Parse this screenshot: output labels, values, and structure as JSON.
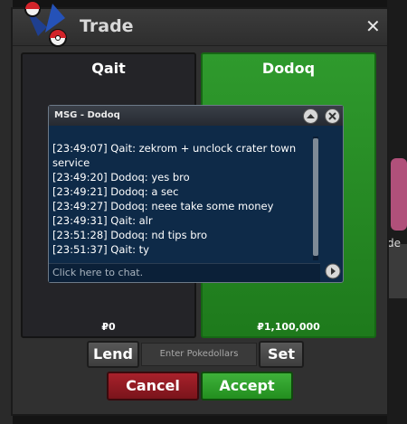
{
  "window": {
    "title": "Trade"
  },
  "trade": {
    "left_name": "Qait",
    "right_name": "Dodoq",
    "left_money": "₽0",
    "right_money": "₽1,100,000"
  },
  "controls": {
    "lend_label": "Lend",
    "money_placeholder": "Enter Pokedollars",
    "set_label": "Set",
    "cancel_label": "Cancel",
    "accept_label": "Accept"
  },
  "chat": {
    "title": "MSG - Dodoq",
    "messages": [
      "[23:49:07] Qait: zekrom + unclock crater town service",
      "[23:49:20] Dodoq: yes bro",
      "[23:49:21] Dodoq: a sec",
      "[23:49:27] Dodoq: neee take some money",
      "[23:49:31] Qait: alr",
      "[23:51:28] Dodoq: nd tips bro",
      "[23:51:37] Qait: ty"
    ],
    "input_placeholder": "Click here to chat."
  },
  "background": {
    "partial_text": "de"
  },
  "colors": {
    "accept": "#2e9e2a",
    "cancel": "#8e1a22",
    "chat_bg": "#0e2a48"
  }
}
